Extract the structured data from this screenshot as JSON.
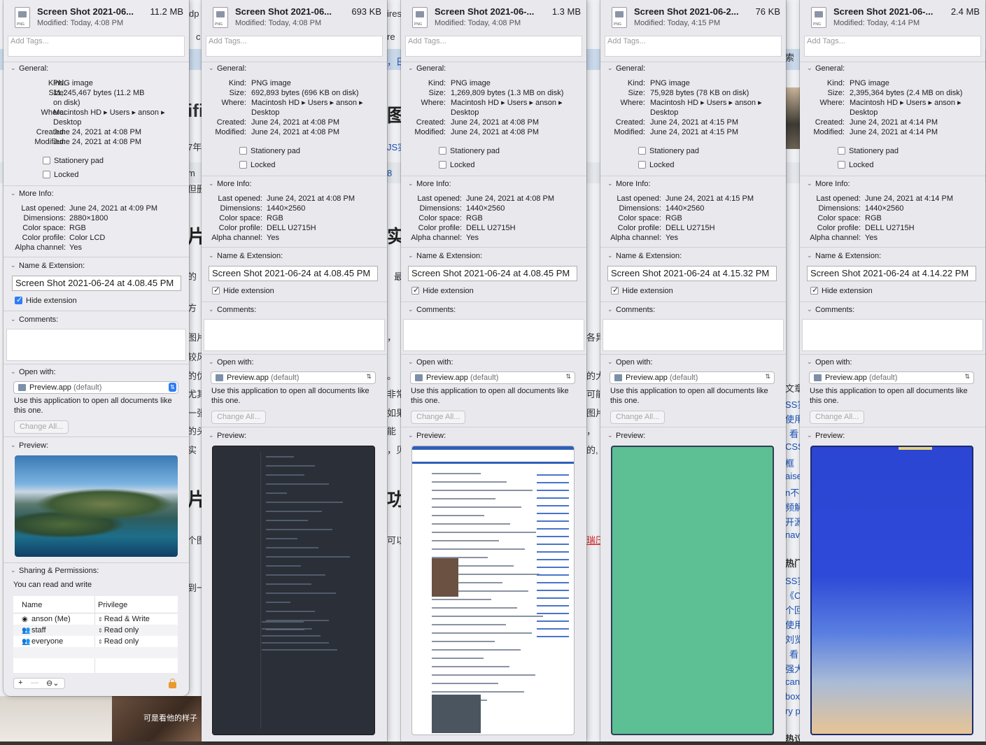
{
  "background": {
    "chars_left": [
      "片",
      "片"
    ],
    "chars_mid": [
      "图",
      "实",
      "功"
    ],
    "snippets": [
      "dp",
      "c",
      "ifi",
      "7年",
      "m",
      "但删",
      "的",
      "方",
      "图片",
      "较风",
      "的优",
      "尤其",
      "一张",
      "的头",
      "实",
      "个图",
      "到一",
      "ires",
      "re",
      "，日",
      "JS实",
      "8",
      "最",
      "，",
      "。",
      "非常",
      "如果",
      "能",
      "，贝",
      "可以",
      "各异",
      "的大",
      "可能",
      "图片",
      "，",
      "的,",
      "瑞压",
      "索",
      "文章",
      "SS实",
      "使用",
      "看",
      "CSS",
      "框",
      "aise",
      "n不",
      "频解",
      "开源",
      "navi",
      "热门",
      "SS实",
      "《C",
      "个回",
      "使用",
      "刘览",
      "看",
      "强大",
      "can",
      "box",
      "ry p",
      "热议"
    ],
    "subtitle_caption": "可是看他的样子"
  },
  "panels": [
    {
      "file_name": "Screen Shot 2021-06...",
      "file_size": "11.2 MB",
      "modified": "Modified: Today, 4:08 PM",
      "tags_placeholder": "Add Tags...",
      "general_label": "General:",
      "kind_label": "Kind:",
      "kind": "PNG image",
      "size_label": "Size:",
      "size": "11,245,467 bytes (11.2 MB\non disk)",
      "where_label": "Where:",
      "where": "Macintosh HD ▸ Users ▸ anson ▸\nDesktop",
      "created_label": "Created:",
      "created": "June 24, 2021 at 4:08 PM",
      "modified_label": "Modified:",
      "modified_full": "June 24, 2021 at 4:08 PM",
      "stationery_label": "Stationery pad",
      "locked_label": "Locked",
      "more_info_label": "More Info:",
      "last_opened_label": "Last opened:",
      "last_opened": "June 24, 2021 at 4:09 PM",
      "dimensions_label": "Dimensions:",
      "dimensions": "2880×1800",
      "color_space_label": "Color space:",
      "color_space": "RGB",
      "color_profile_label": "Color profile:",
      "color_profile": "Color LCD",
      "alpha_label": "Alpha channel:",
      "alpha": "Yes",
      "name_ext_label": "Name & Extension:",
      "name_value": "Screen Shot 2021-06-24 at 4.08.45 PM",
      "hide_ext_label": "Hide extension",
      "comments_label": "Comments:",
      "open_with_label": "Open with:",
      "app_name": "Preview.app",
      "app_default": "(default)",
      "use_text": "Use this application to open all documents like this one.",
      "change_all": "Change All...",
      "preview_label": "Preview:",
      "sharing_label": "Sharing & Permissions:",
      "sharing_text": "You can read and write",
      "perm_header_name": "Name",
      "perm_header_priv": "Privilege",
      "perms": [
        {
          "icon": "user-icon",
          "name": "anson (Me)",
          "priv": "Read & Write"
        },
        {
          "icon": "group-icon",
          "name": "staff",
          "priv": "Read only"
        },
        {
          "icon": "everyone-icon",
          "name": "everyone",
          "priv": "Read only"
        }
      ]
    },
    {
      "file_name": "Screen Shot 2021-06...",
      "file_size": "693 KB",
      "modified": "Modified: Today, 4:08 PM",
      "tags_placeholder": "Add Tags...",
      "general_label": "General:",
      "kind_label": "Kind:",
      "kind": "PNG image",
      "size_label": "Size:",
      "size": "692,893 bytes (696 KB on disk)",
      "where_label": "Where:",
      "where": "Macintosh HD ▸ Users ▸ anson ▸\nDesktop",
      "created_label": "Created:",
      "created": "June 24, 2021 at 4:08 PM",
      "modified_label": "Modified:",
      "modified_full": "June 24, 2021 at 4:08 PM",
      "stationery_label": "Stationery pad",
      "locked_label": "Locked",
      "more_info_label": "More Info:",
      "last_opened_label": "Last opened:",
      "last_opened": "June 24, 2021 at 4:08 PM",
      "dimensions_label": "Dimensions:",
      "dimensions": "1440×2560",
      "color_space_label": "Color space:",
      "color_space": "RGB",
      "color_profile_label": "Color profile:",
      "color_profile": "DELL U2715H",
      "alpha_label": "Alpha channel:",
      "alpha": "Yes",
      "name_ext_label": "Name & Extension:",
      "name_value": "Screen Shot 2021-06-24 at 4.08.45 PM",
      "hide_ext_label": "Hide extension",
      "comments_label": "Comments:",
      "open_with_label": "Open with:",
      "app_name": "Preview.app",
      "app_default": "(default)",
      "use_text": "Use this application to open all documents like this one.",
      "change_all": "Change All...",
      "preview_label": "Preview:"
    },
    {
      "file_name": "Screen Shot 2021-06-...",
      "file_size": "1.3 MB",
      "modified": "Modified: Today, 4:08 PM",
      "tags_placeholder": "Add Tags...",
      "general_label": "General:",
      "kind_label": "Kind:",
      "kind": "PNG image",
      "size_label": "Size:",
      "size": "1,269,809 bytes (1.3 MB on disk)",
      "where_label": "Where:",
      "where": "Macintosh HD ▸ Users ▸ anson ▸\nDesktop",
      "created_label": "Created:",
      "created": "June 24, 2021 at 4:08 PM",
      "modified_label": "Modified:",
      "modified_full": "June 24, 2021 at 4:08 PM",
      "stationery_label": "Stationery pad",
      "locked_label": "Locked",
      "more_info_label": "More Info:",
      "last_opened_label": "Last opened:",
      "last_opened": "June 24, 2021 at 4:08 PM",
      "dimensions_label": "Dimensions:",
      "dimensions": "1440×2560",
      "color_space_label": "Color space:",
      "color_space": "RGB",
      "color_profile_label": "Color profile:",
      "color_profile": "DELL U2715H",
      "alpha_label": "Alpha channel:",
      "alpha": "Yes",
      "name_ext_label": "Name & Extension:",
      "name_value": "Screen Shot 2021-06-24 at 4.08.45 PM",
      "hide_ext_label": "Hide extension",
      "comments_label": "Comments:",
      "open_with_label": "Open with:",
      "app_name": "Preview.app",
      "app_default": "(default)",
      "use_text": "Use this application to open all documents like this one.",
      "change_all": "Change All...",
      "preview_label": "Preview:"
    },
    {
      "file_name": "Screen Shot 2021-06-2...",
      "file_size": "76 KB",
      "modified": "Modified: Today, 4:15 PM",
      "tags_placeholder": "Add Tags...",
      "general_label": "General:",
      "kind_label": "Kind:",
      "kind": "PNG image",
      "size_label": "Size:",
      "size": "75,928 bytes (78 KB on disk)",
      "where_label": "Where:",
      "where": "Macintosh HD ▸ Users ▸ anson ▸\nDesktop",
      "created_label": "Created:",
      "created": "June 24, 2021 at 4:15 PM",
      "modified_label": "Modified:",
      "modified_full": "June 24, 2021 at 4:15 PM",
      "stationery_label": "Stationery pad",
      "locked_label": "Locked",
      "more_info_label": "More Info:",
      "last_opened_label": "Last opened:",
      "last_opened": "June 24, 2021 at 4:15 PM",
      "dimensions_label": "Dimensions:",
      "dimensions": "1440×2560",
      "color_space_label": "Color space:",
      "color_space": "RGB",
      "color_profile_label": "Color profile:",
      "color_profile": "DELL U2715H",
      "alpha_label": "Alpha channel:",
      "alpha": "Yes",
      "name_ext_label": "Name & Extension:",
      "name_value": "Screen Shot 2021-06-24 at 4.15.32 PM",
      "hide_ext_label": "Hide extension",
      "comments_label": "Comments:",
      "open_with_label": "Open with:",
      "app_name": "Preview.app",
      "app_default": "(default)",
      "use_text": "Use this application to open all documents like this one.",
      "change_all": "Change All...",
      "preview_label": "Preview:"
    },
    {
      "file_name": "Screen Shot 2021-06-...",
      "file_size": "2.4 MB",
      "modified": "Modified: Today, 4:14 PM",
      "tags_placeholder": "Add Tags...",
      "general_label": "General:",
      "kind_label": "Kind:",
      "kind": "PNG image",
      "size_label": "Size:",
      "size": "2,395,364 bytes (2.4 MB on disk)",
      "where_label": "Where:",
      "where": "Macintosh HD ▸ Users ▸ anson ▸\nDesktop",
      "created_label": "Created:",
      "created": "June 24, 2021 at 4:14 PM",
      "modified_label": "Modified:",
      "modified_full": "June 24, 2021 at 4:14 PM",
      "stationery_label": "Stationery pad",
      "locked_label": "Locked",
      "more_info_label": "More Info:",
      "last_opened_label": "Last opened:",
      "last_opened": "June 24, 2021 at 4:14 PM",
      "dimensions_label": "Dimensions:",
      "dimensions": "1440×2560",
      "color_space_label": "Color space:",
      "color_space": "RGB",
      "color_profile_label": "Color profile:",
      "color_profile": "DELL U2715H",
      "alpha_label": "Alpha channel:",
      "alpha": "Yes",
      "name_ext_label": "Name & Extension:",
      "name_value": "Screen Shot 2021-06-24 at 4.14.22 PM",
      "hide_ext_label": "Hide extension",
      "comments_label": "Comments:",
      "open_with_label": "Open with:",
      "app_name": "Preview.app",
      "app_default": "(default)",
      "use_text": "Use this application to open all documents like this one.",
      "change_all": "Change All...",
      "preview_label": "Preview:"
    }
  ],
  "colors": {
    "accent": "#2f7df6",
    "panel_bg": "#e8e8ed",
    "green_preview": "#5dbf94",
    "blue_preview": "#2e4ad8",
    "lock_orange": "#e99a2c"
  }
}
